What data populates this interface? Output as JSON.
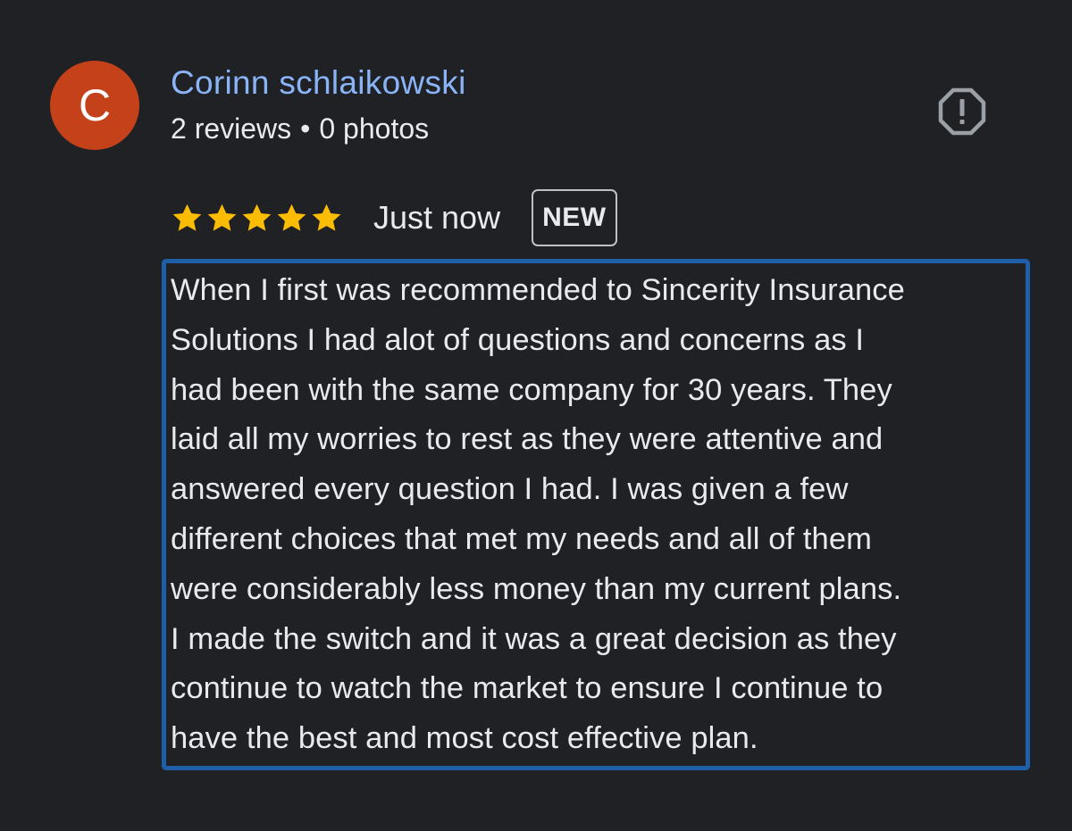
{
  "author": {
    "initial": "C",
    "name": "Corinn schlaikowski",
    "reviews": "2 reviews",
    "separator": "•",
    "photos": "0 photos",
    "avatar_color": "#c5411a"
  },
  "actions": {
    "report_icon": "report-octagon-icon"
  },
  "rating": {
    "stars": 5,
    "star_color": "#fbbc04",
    "time": "Just now",
    "badge": "NEW"
  },
  "review": {
    "lines": [
      "When I first was recommended to Sincerity Insurance",
      "Solutions I had alot of questions and concerns as I",
      "had been with the same company for 30 years. They",
      "laid all my worries to rest as they were attentive and",
      "answered every question I had. I was given a few",
      "different choices that met my needs and all of them",
      "were considerably less money than my current plans.",
      "I made the switch and it was a great decision as they",
      "continue to watch the market to ensure I continue to",
      "have the best and most cost effective plan."
    ],
    "highlight_color": "#1f5fa8"
  }
}
